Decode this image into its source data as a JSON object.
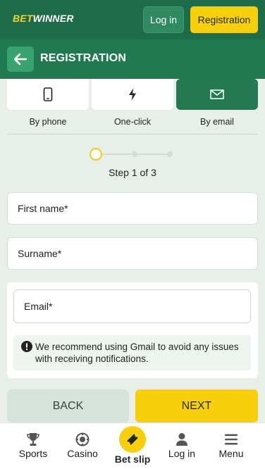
{
  "header": {
    "logo_bet": "BET",
    "logo_winner": "WINNER",
    "login_label": "Log in",
    "registration_label": "Registration"
  },
  "subheader": {
    "title": "REGISTRATION"
  },
  "methods": [
    {
      "label": "By phone",
      "icon": "phone-icon",
      "active": false
    },
    {
      "label": "One-click",
      "icon": "lightning-icon",
      "active": false
    },
    {
      "label": "By email",
      "icon": "envelope-icon",
      "active": true
    }
  ],
  "stepper": {
    "current": 1,
    "total": 3,
    "text": "Step 1 of 3"
  },
  "form": {
    "first_name_placeholder": "First name*",
    "surname_placeholder": "Surname*",
    "email_placeholder": "Email*",
    "notice": "We recommend using Gmail to avoid any issues with receiving notifications."
  },
  "actions": {
    "back_label": "BACK",
    "next_label": "NEXT"
  },
  "bottom_nav": [
    {
      "label": "Sports",
      "icon": "trophy-icon"
    },
    {
      "label": "Casino",
      "icon": "casino-chip-icon"
    },
    {
      "label": "Bet slip",
      "icon": "ticket-icon"
    },
    {
      "label": "Log in",
      "icon": "user-icon"
    },
    {
      "label": "Menu",
      "icon": "menu-icon"
    }
  ],
  "colors": {
    "brand_green": "#1e6b4a",
    "accent_yellow": "#f8cf0b",
    "active_tab": "#237a52"
  }
}
